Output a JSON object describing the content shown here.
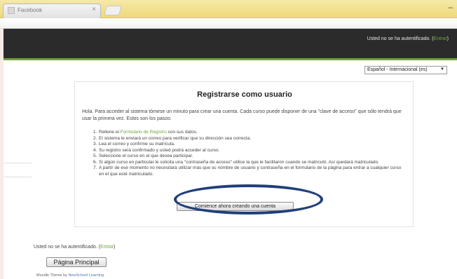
{
  "browser": {
    "tab_title": "Facebook",
    "tab_close": "×",
    "window_minimize": "–"
  },
  "header": {
    "login_status": "Usted no se ha autentificado. (",
    "login_link": "Entrar",
    "login_close": ")"
  },
  "language_select": {
    "selected": "Español - Internacional (es)",
    "arrow": "▼"
  },
  "content": {
    "title": "Registrarse como usuario",
    "intro": "Hola. Para acceder al sistema tómese un minuto para crear una cuenta. Cada curso puede disponer de una \"clave de acceso\" que sólo tendrá que usar la primera vez. Estos son los pasos:",
    "steps": [
      {
        "num": "1.",
        "pre": "Rellene el ",
        "link": "Formulario de Registro",
        "post": " con sus datos."
      },
      {
        "num": "2.",
        "text": "El sistema le enviará un correo para verificar que su dirección sea correcta."
      },
      {
        "num": "3.",
        "text": "Lea el correo y confirme su matrícula."
      },
      {
        "num": "4.",
        "text": "Su registro será confirmado y usted podrá acceder al curso."
      },
      {
        "num": "5.",
        "text": "Seleccione el curso en el que desea participar."
      },
      {
        "num": "6.",
        "text": "Si algún curso en particular le solicita una \"contraseña de acceso\" utilice la que le facilitaron cuando se matriculó. Así quedará matriculado."
      },
      {
        "num": "7.",
        "text": "A partir de ese momento no necesitará utilizar más que su nombre de usuario y contraseña en el formulario de la página para entrar a cualquier curso en el que esté matriculado."
      }
    ],
    "start_button": "Comience ahora creando una cuenta"
  },
  "footer": {
    "login_status": "Usted no se ha autentificado. (",
    "login_link": "Entrar",
    "login_close": ")",
    "home_button": "Página Principal",
    "theme_prefix": "Moodle Theme by ",
    "theme_link": "NewSchool Learning"
  },
  "colors": {
    "header_bg": "#2b2b2b",
    "accent_green": "#6fa13a",
    "annotation_ellipse": "#1f3f7a"
  }
}
